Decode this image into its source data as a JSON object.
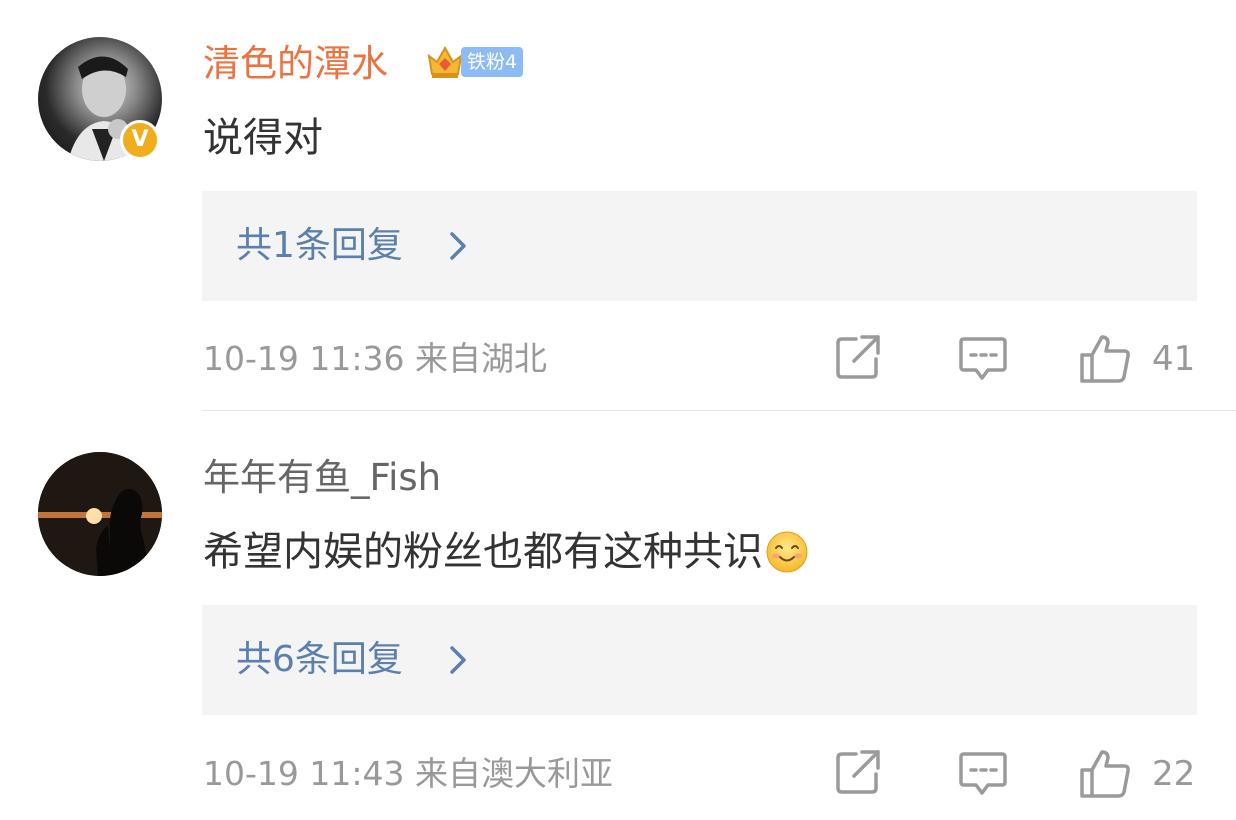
{
  "comments": [
    {
      "username": "清色的潭水",
      "verified_badge": "V",
      "fan_badge": "铁粉4",
      "text": "说得对",
      "replies_label": "共1条回复",
      "timestamp": "10-19 11:36",
      "location": "来自湖北",
      "likes": "41"
    },
    {
      "username": "年年有鱼_Fish",
      "text": "希望内娱的粉丝也都有这种共识",
      "emoji": "smile-emoji",
      "replies_label": "共6条回复",
      "timestamp": "10-19 11:43",
      "location": "来自澳大利亚",
      "likes": "22"
    }
  ],
  "icons": [
    "share-icon",
    "comment-icon",
    "like-icon",
    "chevron-right-icon",
    "crown-icon"
  ],
  "colors": {
    "username_highlight": "#eb7340",
    "username_normal": "#666666",
    "link_blue": "#5b80ad",
    "meta_gray": "#999999",
    "badge_blue": "#8dbbf5",
    "verified_gold": "#f2ad1c",
    "reply_box_bg": "#f4f4f4"
  }
}
